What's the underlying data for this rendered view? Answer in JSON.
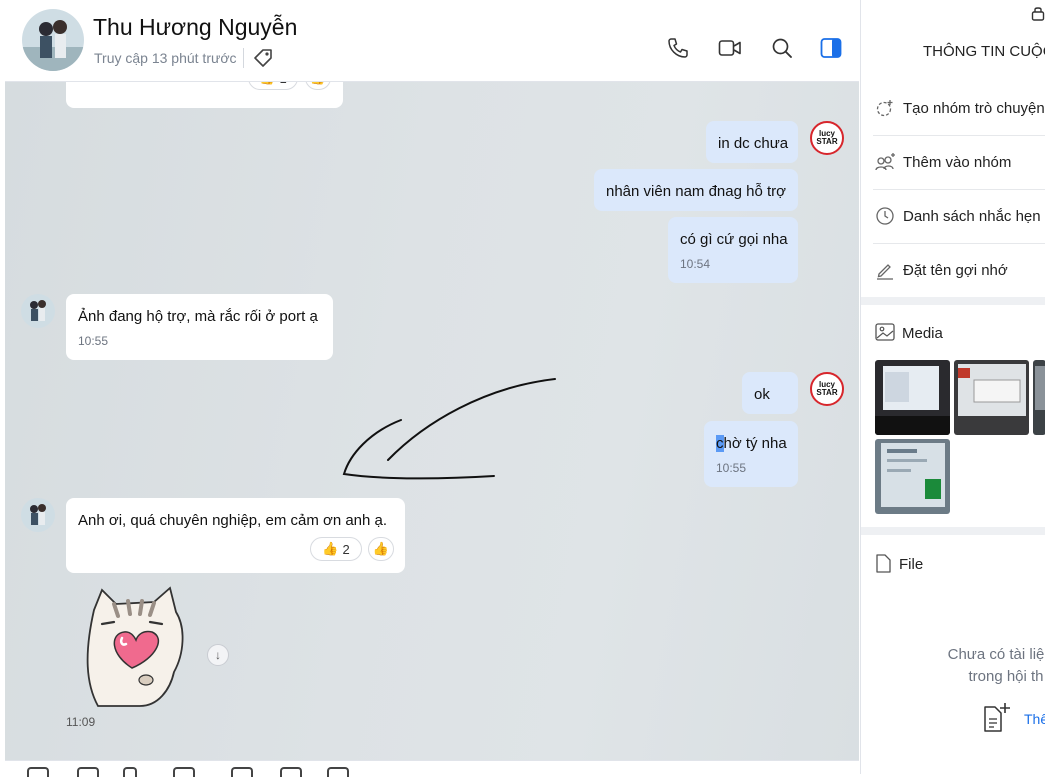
{
  "header": {
    "contact_name": "Thu Hương Nguyễn",
    "last_seen": "Truy cập 13 phút trước",
    "icons": [
      "tag-icon",
      "phone-icon",
      "video-icon",
      "search-icon",
      "sidebar-toggle-icon"
    ]
  },
  "chat": {
    "top_reaction": {
      "emoji": "👍",
      "count": "1"
    },
    "messages": [
      {
        "side": "out",
        "text": "in dc chưa"
      },
      {
        "side": "out",
        "text": "nhân viên nam đnag hỗ trợ"
      },
      {
        "side": "out",
        "text": "có gì cứ gọi nha",
        "time": "10:54"
      },
      {
        "side": "in",
        "text": "Ảnh đang hộ trợ,  mà rắc rối ở port ạ",
        "time": "10:55"
      },
      {
        "side": "out",
        "text": "ok"
      },
      {
        "side": "out",
        "text_first": "c",
        "text_rest": "hờ tý nha",
        "time": "10:55"
      },
      {
        "side": "in",
        "text": "Anh ơi,  quá chuyên nghiệp,  em cảm ơn anh ạ.",
        "reaction": {
          "emoji": "👍",
          "count": "2"
        }
      }
    ],
    "sticker_time": "11:09",
    "sender_avatar_text": "lucy STAR"
  },
  "panel": {
    "title": "THÔNG TIN CUỘC",
    "actions": [
      "Tạo nhóm trò chuyện",
      "Thêm vào nhóm",
      "Danh sách nhắc hẹn",
      "Đặt tên gợi nhớ"
    ],
    "media_label": "Media",
    "file_label": "File",
    "empty_line1": "Chưa có tài liệu c",
    "empty_line2": "trong hội th",
    "add_file_label": "Thê"
  },
  "colors": {
    "accent": "#1a6fe8",
    "out_bubble": "#dbe8fb",
    "in_bubble": "#ffffff"
  }
}
